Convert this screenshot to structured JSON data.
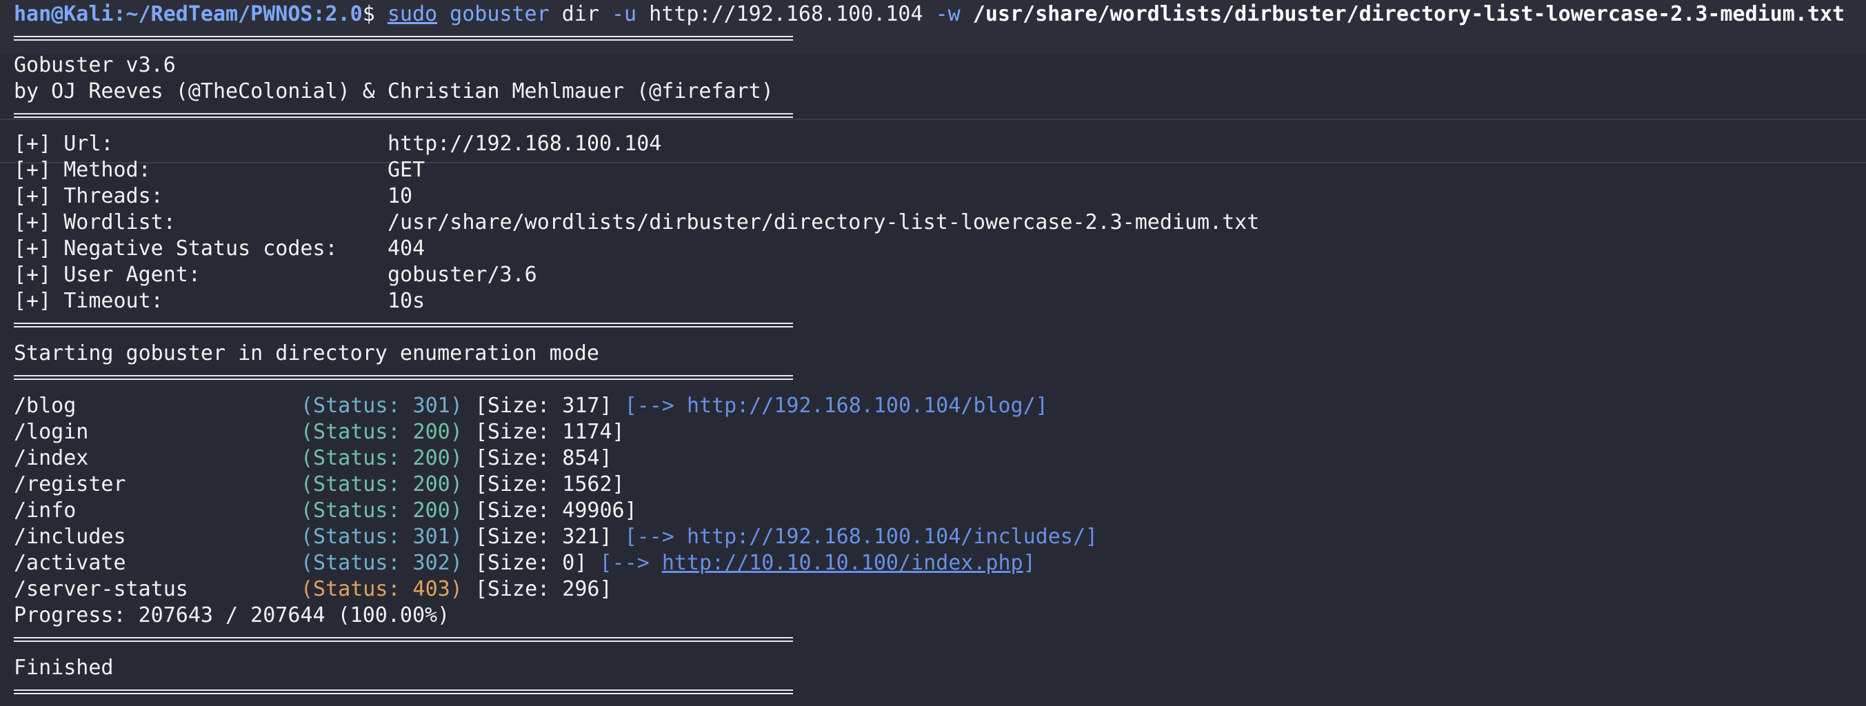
{
  "prompt": {
    "user_host": "han@Kali",
    "path": ":~/RedTeam/PWNOS:2.0",
    "symbol": "$ "
  },
  "command": {
    "sudo": "sudo",
    "tool": "gobuster",
    "mode": "dir",
    "url_flag": "-u",
    "url": "http://192.168.100.104",
    "wordlist_flag": "-w",
    "wordlist": "/usr/share/wordlists/dirbuster/directory-list-lowercase-2.3-medium.txt"
  },
  "banner": {
    "version": "Gobuster v3.6",
    "authors": "by OJ Reeves (@TheColonial) & Christian Mehlmauer (@firefart)"
  },
  "config": [
    {
      "label": "[+] Url:",
      "value": "http://192.168.100.104"
    },
    {
      "label": "[+] Method:",
      "value": "GET"
    },
    {
      "label": "[+] Threads:",
      "value": "10"
    },
    {
      "label": "[+] Wordlist:",
      "value": "/usr/share/wordlists/dirbuster/directory-list-lowercase-2.3-medium.txt"
    },
    {
      "label": "[+] Negative Status codes:",
      "value": "404"
    },
    {
      "label": "[+] User Agent:",
      "value": "gobuster/3.6"
    },
    {
      "label": "[+] Timeout:",
      "value": "10s"
    }
  ],
  "start_message": "Starting gobuster in directory enumeration mode",
  "results": [
    {
      "path": "/blog",
      "status": "(Status: 301)",
      "size": "[Size: 317]",
      "redirect_open": "[-->",
      "redirect_url": "http://192.168.100.104/blog/",
      "redirect_close": "]",
      "code": "301"
    },
    {
      "path": "/login",
      "status": "(Status: 200)",
      "size": "[Size: 1174]",
      "code": "200"
    },
    {
      "path": "/index",
      "status": "(Status: 200)",
      "size": "[Size: 854]",
      "code": "200"
    },
    {
      "path": "/register",
      "status": "(Status: 200)",
      "size": "[Size: 1562]",
      "code": "200"
    },
    {
      "path": "/info",
      "status": "(Status: 200)",
      "size": "[Size: 49906]",
      "code": "200"
    },
    {
      "path": "/includes",
      "status": "(Status: 301)",
      "size": "[Size: 321]",
      "redirect_open": "[-->",
      "redirect_url": "http://192.168.100.104/includes/",
      "redirect_close": "]",
      "code": "301"
    },
    {
      "path": "/activate",
      "status": "(Status: 302)",
      "size": "[Size: 0]",
      "redirect_open": "[-->",
      "redirect_url": "http://10.10.10.100/index.php",
      "redirect_close": "]",
      "code": "302"
    },
    {
      "path": "/server-status",
      "status": "(Status: 403)",
      "size": "[Size: 296]",
      "code": "403"
    }
  ],
  "progress": "Progress: 207643 / 207644 (100.00%)",
  "finished": "Finished",
  "colors": {
    "background": "#272a34",
    "prompt": "#7ea7ff",
    "status_200": "#6fc1a6",
    "status_301": "#6fb1ce",
    "status_403": "#e0a35d",
    "redirect": "#6790e8"
  }
}
